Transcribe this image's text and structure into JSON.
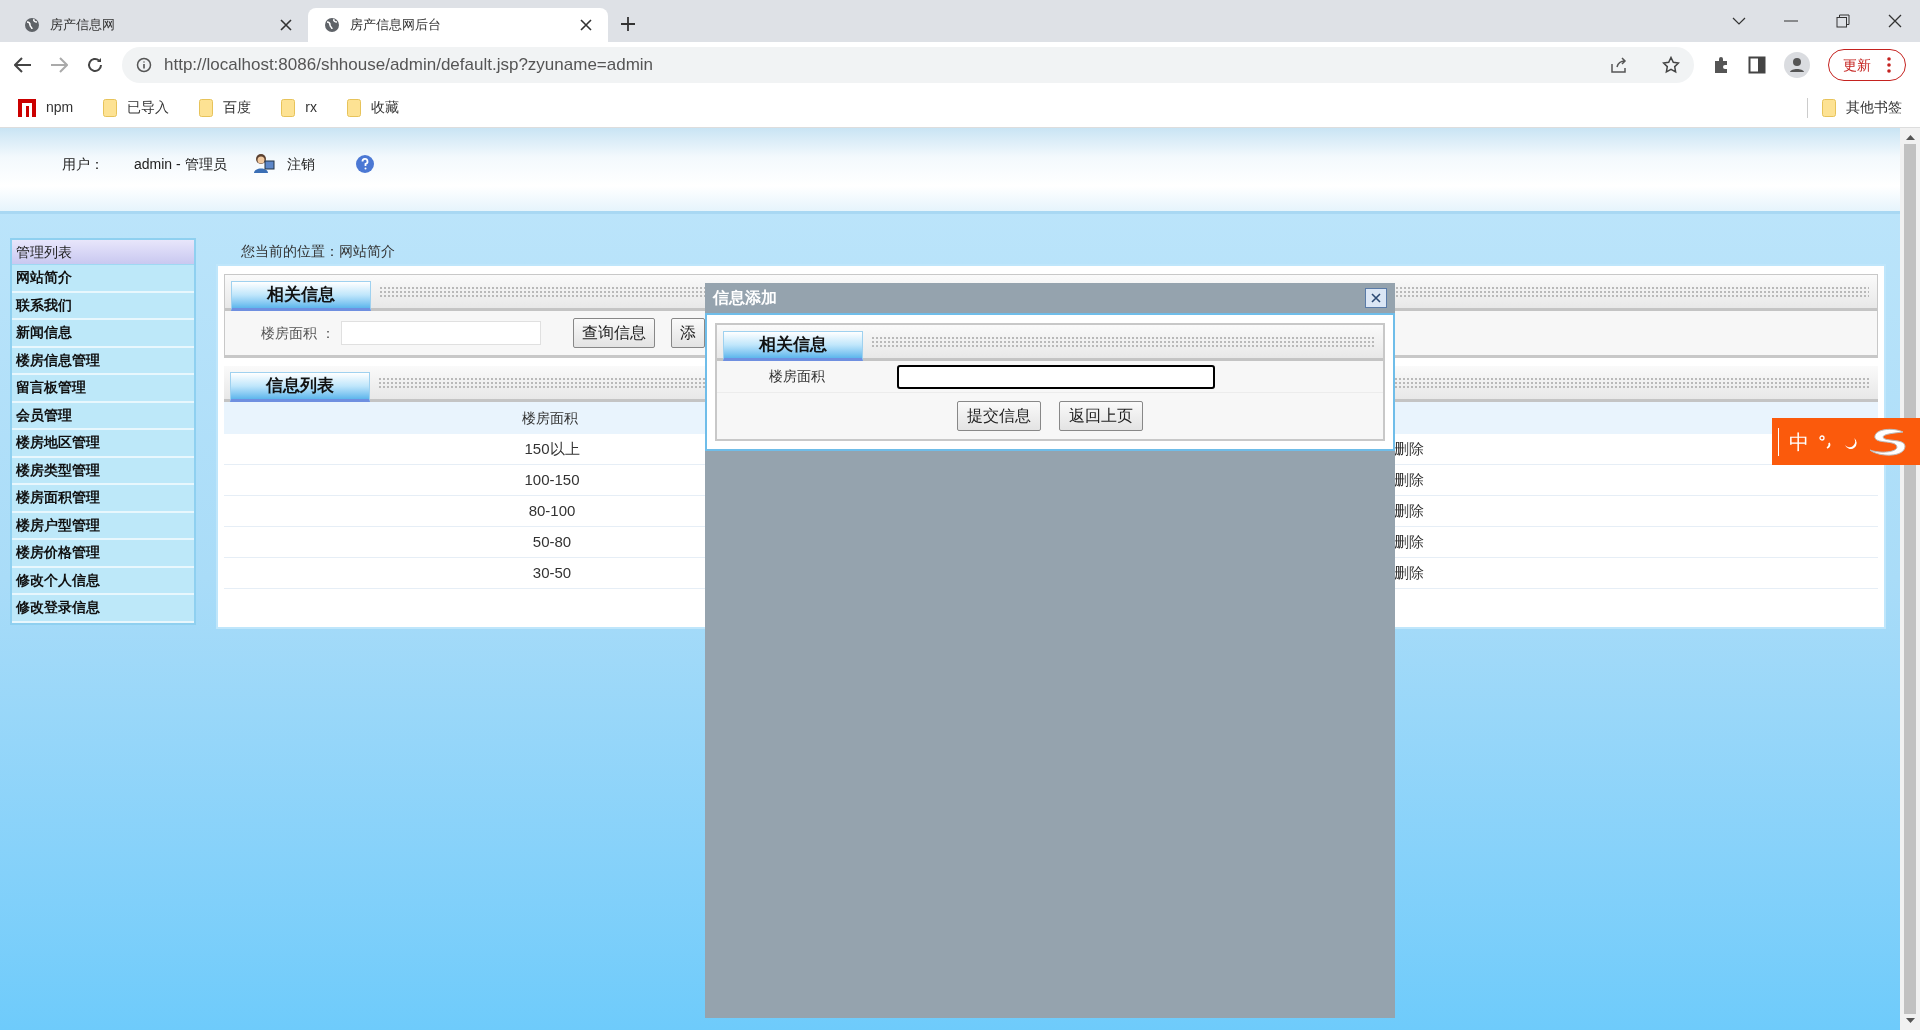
{
  "browser": {
    "tabs": [
      {
        "title": "房产信息网",
        "selected": false
      },
      {
        "title": "房产信息网后台",
        "selected": true
      }
    ],
    "url": "http://localhost:8086/shhouse/admin/default.jsp?zyuname=admin",
    "update_button": "更新",
    "bookmarks": [
      {
        "label": "npm",
        "kind": "npm"
      },
      {
        "label": "已导入",
        "kind": "folder"
      },
      {
        "label": "百度",
        "kind": "folder"
      },
      {
        "label": "rx",
        "kind": "folder"
      },
      {
        "label": "收藏",
        "kind": "folder"
      }
    ],
    "other_bookmarks": "其他书签"
  },
  "header": {
    "user_label": "用户：",
    "user": "admin - 管理员",
    "logout": "注销"
  },
  "sidebar": {
    "title": "管理列表",
    "items": [
      "网站简介",
      "联系我们",
      "新闻信息",
      "楼房信息管理",
      "留言板管理",
      "会员管理",
      "楼房地区管理",
      "楼房类型管理",
      "楼房面积管理",
      "楼房户型管理",
      "楼房价格管理",
      "修改个人信息",
      "修改登录信息"
    ]
  },
  "breadcrumb": "您当前的位置：网站简介",
  "search_section": {
    "title": "相关信息",
    "field_label": "楼房面积 ：",
    "buttons": [
      "查询信息",
      "添"
    ]
  },
  "list_section": {
    "title": "信息列表",
    "columns": [
      "楼房面积"
    ],
    "rows": [
      {
        "area": "150以上",
        "action": "删除"
      },
      {
        "area": "100-150",
        "action": "删除"
      },
      {
        "area": "80-100",
        "action": "删除"
      },
      {
        "area": "50-80",
        "action": "删除"
      },
      {
        "area": "30-50",
        "action": "删除"
      }
    ]
  },
  "dialog": {
    "title": "信息添加",
    "section_title": "相关信息",
    "field_label": "楼房面积",
    "field_focused": true,
    "buttons": [
      "提交信息",
      "返回上页"
    ]
  },
  "ime": {
    "mode": "中"
  }
}
